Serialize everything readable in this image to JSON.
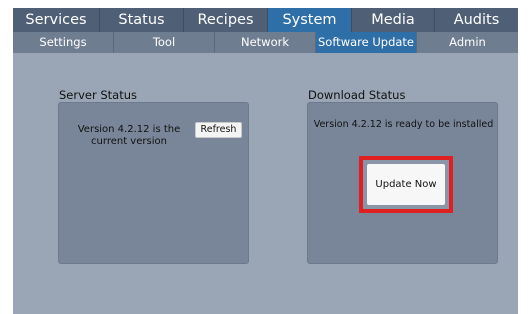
{
  "nav": {
    "main_tabs": [
      "Services",
      "Status",
      "Recipes",
      "System",
      "Media",
      "Audits"
    ],
    "active_main": "System",
    "sub_tabs": [
      "Settings",
      "Tool",
      "Network",
      "Software Update",
      "Admin"
    ],
    "active_sub": "Software Update"
  },
  "server_status": {
    "title": "Server Status",
    "message": "Version 4.2.12 is the current version",
    "refresh_label": "Refresh"
  },
  "download_status": {
    "title": "Download Status",
    "message": "Version 4.2.12 is ready to be installed",
    "update_label": "Update Now"
  },
  "colors": {
    "active_tab": "#2f6fa8",
    "highlight": "#e02020"
  }
}
